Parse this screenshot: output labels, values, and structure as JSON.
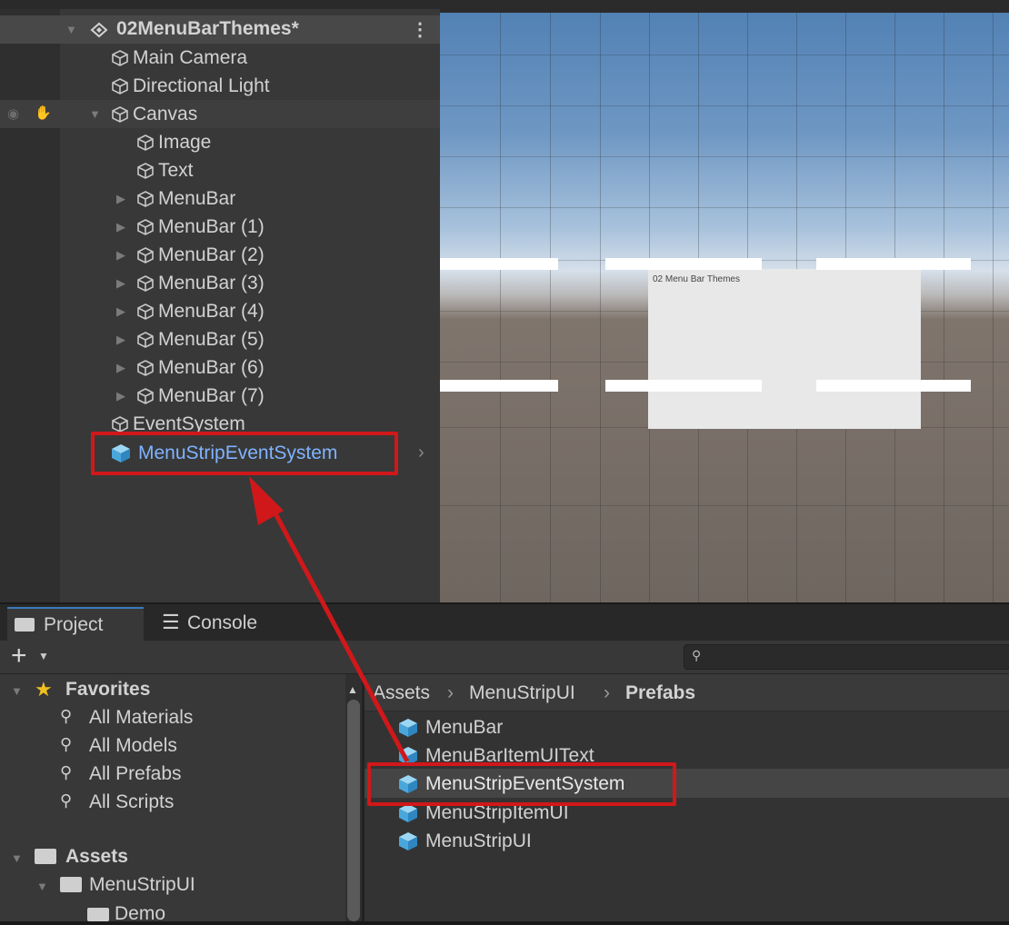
{
  "hierarchy": {
    "scene_name": "02MenuBarThemes*",
    "items": [
      {
        "label": "Main Camera"
      },
      {
        "label": "Directional Light"
      },
      {
        "label": "Canvas"
      },
      {
        "label": "Image"
      },
      {
        "label": "Text"
      },
      {
        "label": "MenuBar"
      },
      {
        "label": "MenuBar (1)"
      },
      {
        "label": "MenuBar (2)"
      },
      {
        "label": "MenuBar (3)"
      },
      {
        "label": "MenuBar (4)"
      },
      {
        "label": "MenuBar (5)"
      },
      {
        "label": "MenuBar (6)"
      },
      {
        "label": "MenuBar (7)"
      },
      {
        "label": "EventSystem"
      },
      {
        "label": "MenuStripEventSystem"
      }
    ]
  },
  "scene": {
    "canvas_title": "02 Menu Bar Themes"
  },
  "project": {
    "tabs": [
      "Project",
      "Console"
    ],
    "favorites": {
      "header": "Favorites",
      "items": [
        "All Materials",
        "All Models",
        "All Prefabs",
        "All Scripts"
      ]
    },
    "assets": {
      "header": "Assets",
      "folder": "MenuStripUI",
      "subfolder": "Demo"
    },
    "breadcrumb": [
      "Assets",
      "MenuStripUI",
      "Prefabs"
    ],
    "prefabs": [
      "MenuBar",
      "MenuBarItemUIText",
      "MenuStripEventSystem",
      "MenuStripItemUI",
      "MenuStripUI"
    ]
  },
  "colors": {
    "selection_text": "#7fb3ff",
    "highlight_box": "#d0181a",
    "prefab_icon": "#5fb8e6"
  }
}
